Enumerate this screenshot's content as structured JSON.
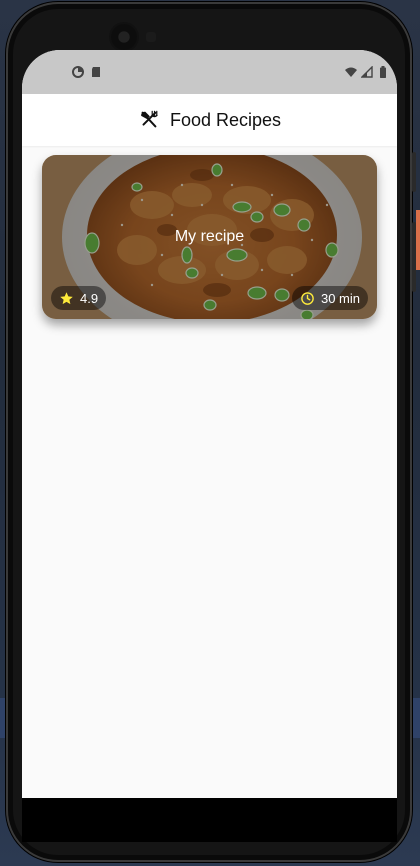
{
  "app": {
    "title": "Food Recipes",
    "title_icon": "restaurant-icon"
  },
  "statusbar": {
    "left_icons": [
      "data-saver-icon",
      "sd-card-icon"
    ],
    "right_icons": [
      "wifi-icon",
      "cellular-signal-icon",
      "battery-icon"
    ]
  },
  "recipes": [
    {
      "title": "My recipe",
      "rating": "4.9",
      "cook_time": "30 min"
    }
  ],
  "colors": {
    "star": "#ffeb3b",
    "clock": "#ffeb3b",
    "statusbar_bg": "#c8c8c8",
    "screen_bg": "#fafafa"
  }
}
